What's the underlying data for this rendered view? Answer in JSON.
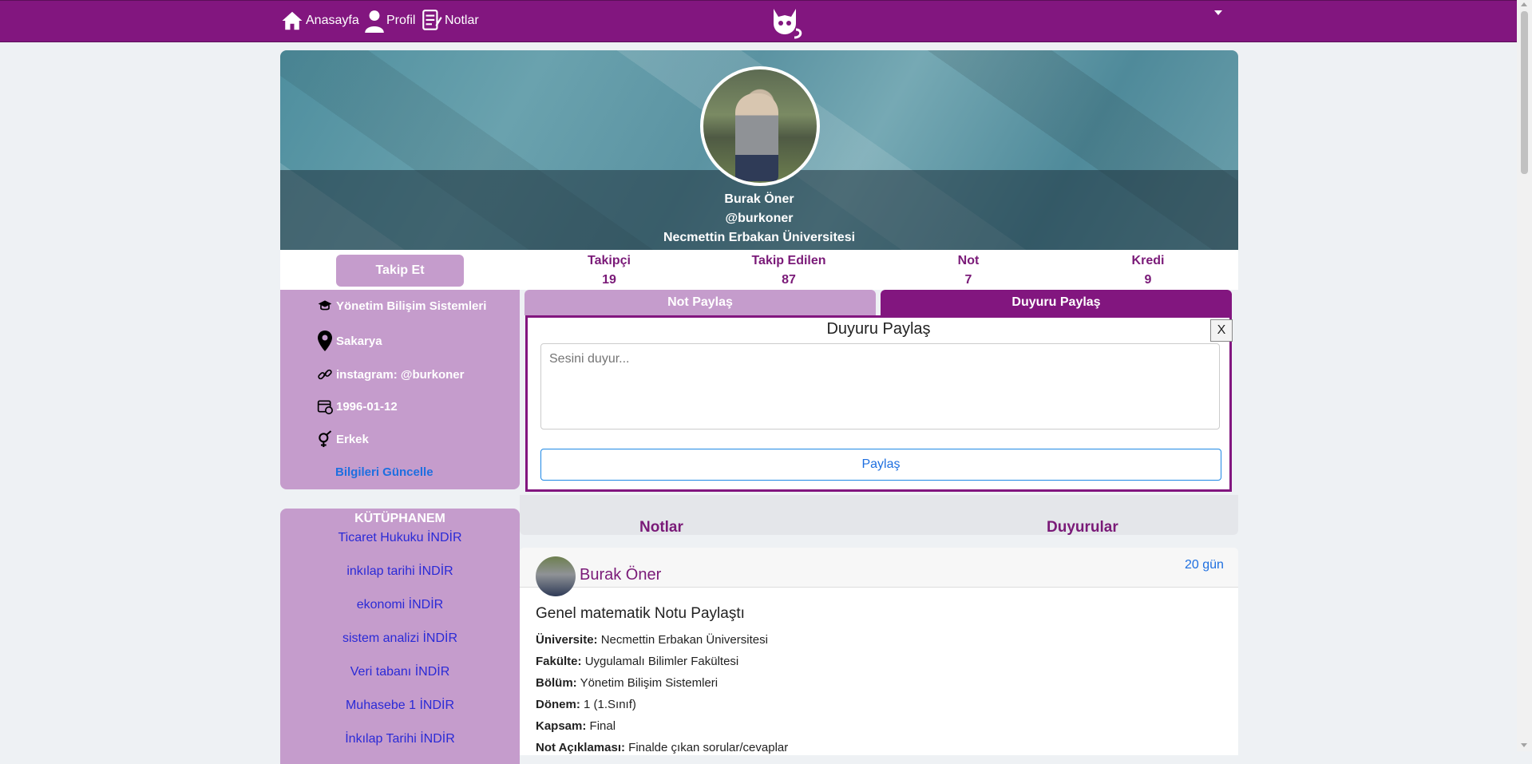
{
  "nav": {
    "home": "Anasayfa",
    "profile": "Profil",
    "notes": "Notlar"
  },
  "profile": {
    "name": "Burak Öner",
    "handle": "@burkoner",
    "university": "Necmettin Erbakan Üniversitesi",
    "follow_label": "Takip Et",
    "stats": [
      {
        "label": "Takipçi",
        "value": "19"
      },
      {
        "label": "Takip Edilen",
        "value": "87"
      },
      {
        "label": "Not",
        "value": "7"
      },
      {
        "label": "Kredi",
        "value": "9"
      }
    ]
  },
  "info": {
    "department": "Yönetim Bilişim Sistemleri",
    "city": "Sakarya",
    "link": "instagram: @burkoner",
    "birthdate": "1996-01-12",
    "gender": "Erkek",
    "update_label": "Bilgileri Güncelle"
  },
  "library": {
    "title": "KÜTÜPHANEM",
    "items": [
      "Ticaret Hukuku İNDİR",
      "inkılap tarihi İNDİR",
      "ekonomi İNDİR",
      "sistem analizi İNDİR",
      "Veri tabanı İNDİR",
      "Muhasebe 1 İNDİR",
      "İnkılap Tarihi İNDİR"
    ]
  },
  "tabs": {
    "note_share": "Not Paylaş",
    "announcement_share": "Duyuru Paylaş"
  },
  "announcement": {
    "title": "Duyuru Paylaş",
    "close": "X",
    "placeholder": "Sesini duyur...",
    "submit": "Paylaş"
  },
  "feed_tabs": {
    "notes": "Notlar",
    "announcements": "Duyurular"
  },
  "post": {
    "author": "Burak Öner",
    "time": "20 gün",
    "title": "Genel matematik Notu Paylaştı",
    "fields": [
      {
        "label": "Üniversite:",
        "value": "Necmettin Erbakan Üniversitesi"
      },
      {
        "label": "Fakülte:",
        "value": "Uygulamalı Bilimler Fakültesi"
      },
      {
        "label": "Bölüm:",
        "value": "Yönetim Bilişim Sistemleri"
      },
      {
        "label": "Dönem:",
        "value": "1 (1.Sınıf)"
      },
      {
        "label": "Kapsam:",
        "value": "Final"
      },
      {
        "label": "Not Açıklaması:",
        "value": "Finalde çıkan sorular/cevaplar"
      }
    ]
  },
  "colors": {
    "brand": "#82167f",
    "light_brand": "#c59ccc",
    "link": "#1e6fe0"
  }
}
